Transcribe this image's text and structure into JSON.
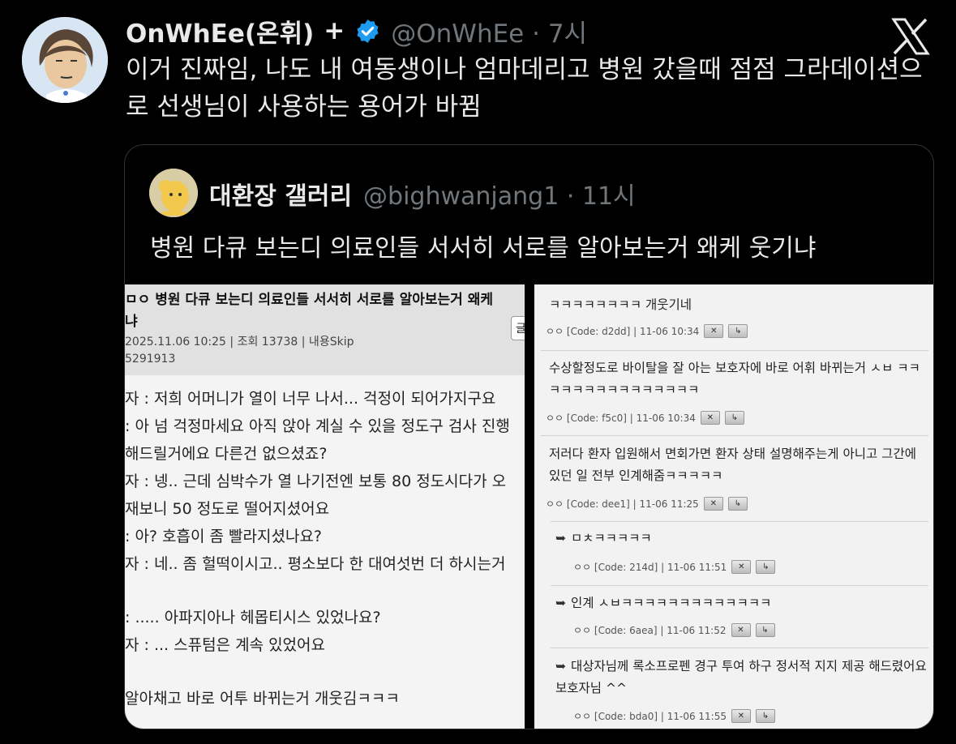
{
  "tweet": {
    "author_name": "OnWhEe(온휘)",
    "plus": "+",
    "handle_time": "@OnWhEe · 7시",
    "text": "이거 진짜임, 나도 내 여동생이나 엄마데리고 병원 갔을때 점점 그라데이션으로 선생님이 사용하는 용어가 바뀜"
  },
  "quote": {
    "author_name": "대환장 갤러리",
    "handle_time": "@bighwanjang1 · 11시",
    "text": "병원 다큐 보는디 의료인들 서서히 서로를 알아보는거 왜케 웃기냐"
  },
  "left_panel": {
    "title_line1": "ㅁㅇ 병원 다큐 보는디 의료인들 서서히 서로를 알아보는거 왜케",
    "title_line2": "냐",
    "meta": "2025.11.06 10:25 | 조회 13738 | 내용Skip",
    "post_id": "5291913",
    "button_label": "글",
    "lines": [
      "자 : 저희 어머니가 열이 너무 나서... 걱정이 되어가지구요",
      ": 아 넘 걱정마세요 아직 앉아 계실 수 있을 정도구 검사 진행",
      "해드릴거에요 다른건 없으셨죠?",
      "자 : 넹.. 근데 심박수가 열 나기전엔 보통 80 정도시다가 오",
      "재보니 50 정도로 떨어지셨어요",
      ": 아? 호흡이 좀 빨라지셨나요?",
      "자 : 네.. 좀 헐떡이시고.. 평소보다 한 대여섯번 더 하시는거",
      ": ..... 아파지아나 헤몹티시스 있었나요?",
      "자 : ... 스퓨텀은 계속 있었어요",
      "알아채고 바로 어투 바뀌는거 개웃김ㅋㅋㅋ"
    ]
  },
  "right_panel": {
    "comments": [
      {
        "text": "ㅋㅋㅋㅋㅋㅋㅋㅋ 개웃기네",
        "meta": "ㅇㅇ [Code: d2dd] | 11-06 10:34",
        "reply": false
      },
      {
        "text": "수상할정도로 바이탈을 잘 아는 보호자에 바로 어휘 바뀌는거 ㅅㅂ ㅋㅋㅋㅋㅋㅋㅋㅋㅋㅋㅋㅋㅋㅋㅋ",
        "meta": "ㅇㅇ [Code: f5c0] | 11-06 10:34",
        "reply": false
      },
      {
        "text": "저러다 환자 입원해서 면회가면 환자 상태 설명해주는게 아니고 그간에 있던 일 전부 인계해줌ㅋㅋㅋㅋㅋ",
        "meta": "ㅇㅇ [Code: dee1] | 11-06 11:25",
        "reply": false
      },
      {
        "text": "ㅁㅊㅋㅋㅋㅋㅋ",
        "meta": "ㅇㅇ [Code: 214d] | 11-06 11:51",
        "reply": true
      },
      {
        "text": "인계 ㅅㅂㅋㅋㅋㅋㅋㅋㅋㅋㅋㅋㅋㅋㅋ",
        "meta": "ㅇㅇ [Code: 6aea] | 11-06 11:52",
        "reply": true
      },
      {
        "text": "대상자님께 록소프로펜 경구 투여 하구 정서적 지지 제공 해드렸어요 보호자님 ^^",
        "meta": "ㅇㅇ [Code: bda0] | 11-06 11:55",
        "reply": true
      }
    ],
    "btn_x": "✕",
    "btn_arrow": "↳"
  },
  "colors": {
    "background": "#000000",
    "text": "#e7e9ea",
    "muted": "#71767b",
    "verified": "#1d9bf0"
  },
  "icons": {
    "verified": "verified-badge-icon",
    "x_logo": "x-logo-icon",
    "reply": "reply-arrow-icon"
  }
}
